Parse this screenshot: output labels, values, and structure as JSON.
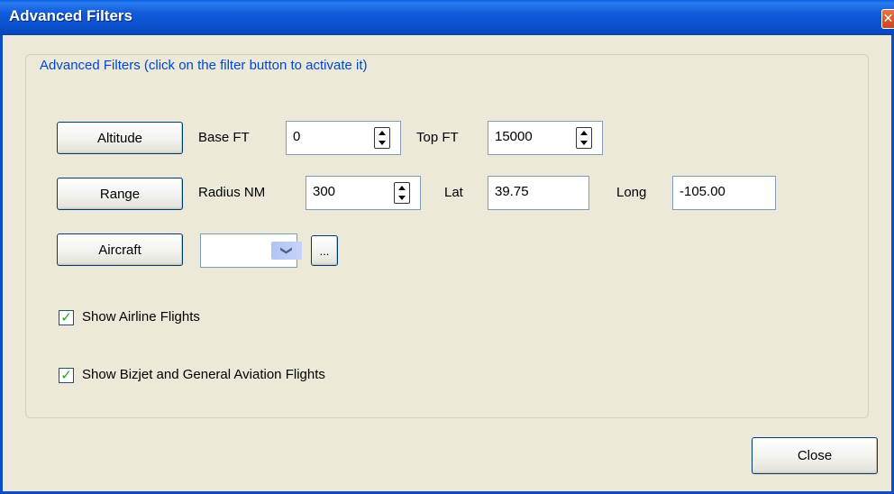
{
  "window": {
    "title": "Advanced Filters",
    "close_glyph": "✕"
  },
  "group": {
    "legend": "Advanced Filters (click on the filter button to activate it)"
  },
  "altitude": {
    "button_label": "Altitude",
    "base_label": "Base FT",
    "base_value": "0",
    "top_label": "Top FT",
    "top_value": "15000"
  },
  "range": {
    "button_label": "Range",
    "radius_label": "Radius NM",
    "radius_value": "300",
    "lat_label": "Lat",
    "lat_value": "39.75",
    "long_label": "Long",
    "long_value": "-105.00"
  },
  "aircraft": {
    "button_label": "Aircraft",
    "selected_value": "",
    "browse_label": "...",
    "dropdown_icon": "chevron-down-icon"
  },
  "options": {
    "airline": {
      "label": "Show Airline Flights",
      "checked": true
    },
    "bizjet": {
      "label": "Show Bizjet and General Aviation Flights",
      "checked": true
    }
  },
  "footer": {
    "close_label": "Close"
  },
  "colors": {
    "title_bar": "#0A50CC",
    "legend_text": "#0046D5",
    "dialog_bg": "#ECE9D8",
    "check": "#21A121"
  }
}
